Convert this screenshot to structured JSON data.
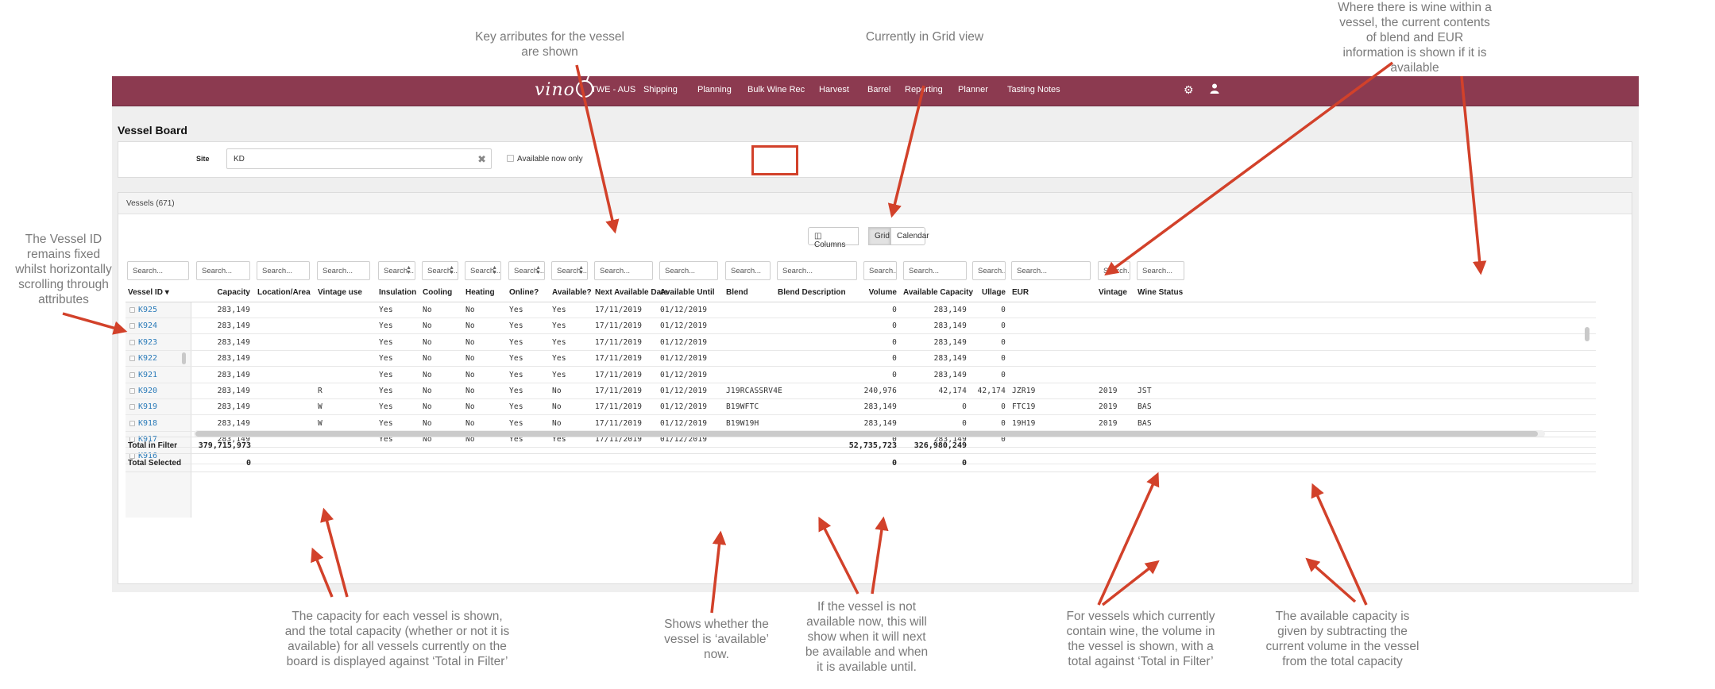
{
  "annotations": {
    "key_attributes": "Key arributes for the vessel\nare shown",
    "grid_view": "Currently in Grid view",
    "wine_contents": "Where there is wine within a\nvessel, the current contents\nof blend and EUR\ninformation is shown if it is\navailable",
    "vessel_id_fixed": "The Vessel ID\nremains fixed\nwhilst horizontally\nscrolling through\nattributes",
    "capacity": "The capacity for each vessel is shown,\nand the total capacity (whether or not it is\navailable) for all vessels currently on the\nboard is displayed against ‘Total in Filter’",
    "available": "Shows whether the\nvessel is ‘available’\nnow.",
    "next_available": "If the vessel is not\navailable now, this will\nshow when it will next\nbe available and when\nit is available until.",
    "volume": "For vessels which currently\ncontain wine, the volume in\nthe vessel is shown, with a\ntotal against ‘Total in Filter’",
    "available_capacity": "The available capacity is\ngiven by subtracting the\ncurrent volume in the vessel\nfrom the total capacity"
  },
  "nav": {
    "logo": "vino",
    "site": "TWE - AUS",
    "items": [
      "Shipping",
      "Planning",
      "Bulk Wine Rec",
      "Harvest",
      "Barrel",
      "Reporting",
      "Planner",
      "Tasting Notes"
    ],
    "settings_icon": "gear-icon",
    "user_icon": "user-icon"
  },
  "page_title": "Vessel Board",
  "filter": {
    "site_label": "Site",
    "site_value": "KD",
    "available_now_label": "Available now only"
  },
  "vessels_header": "Vessels (671)",
  "views": {
    "columns": "Columns",
    "grid": "Grid",
    "calendar": "Calendar",
    "active": "Grid"
  },
  "search_placeholder": "Search...",
  "columns": [
    "Vessel ID",
    "Capacity",
    "Location/Area",
    "Vintage use",
    "Insulation",
    "Cooling",
    "Heating",
    "Online?",
    "Available?",
    "Next Available Date",
    "Available Until",
    "Blend",
    "Blend Description",
    "Volume",
    "Available Capacity",
    "Ullage",
    "EUR",
    "Vintage",
    "Wine Status"
  ],
  "rows": [
    {
      "id": "K925",
      "capacity": "283,149",
      "vintage_use": "",
      "insulation": "Yes",
      "cooling": "No",
      "heating": "No",
      "online": "Yes",
      "available": "Yes",
      "next_date": "17/11/2019",
      "until": "01/12/2019",
      "blend": "",
      "volume": "0",
      "avail_cap": "283,149",
      "ullage": "0",
      "eur": "",
      "vintage": "",
      "status": ""
    },
    {
      "id": "K924",
      "capacity": "283,149",
      "vintage_use": "",
      "insulation": "Yes",
      "cooling": "No",
      "heating": "No",
      "online": "Yes",
      "available": "Yes",
      "next_date": "17/11/2019",
      "until": "01/12/2019",
      "blend": "",
      "volume": "0",
      "avail_cap": "283,149",
      "ullage": "0",
      "eur": "",
      "vintage": "",
      "status": ""
    },
    {
      "id": "K923",
      "capacity": "283,149",
      "vintage_use": "",
      "insulation": "Yes",
      "cooling": "No",
      "heating": "No",
      "online": "Yes",
      "available": "Yes",
      "next_date": "17/11/2019",
      "until": "01/12/2019",
      "blend": "",
      "volume": "0",
      "avail_cap": "283,149",
      "ullage": "0",
      "eur": "",
      "vintage": "",
      "status": ""
    },
    {
      "id": "K922",
      "capacity": "283,149",
      "vintage_use": "",
      "insulation": "Yes",
      "cooling": "No",
      "heating": "No",
      "online": "Yes",
      "available": "Yes",
      "next_date": "17/11/2019",
      "until": "01/12/2019",
      "blend": "",
      "volume": "0",
      "avail_cap": "283,149",
      "ullage": "0",
      "eur": "",
      "vintage": "",
      "status": ""
    },
    {
      "id": "K921",
      "capacity": "283,149",
      "vintage_use": "",
      "insulation": "Yes",
      "cooling": "No",
      "heating": "No",
      "online": "Yes",
      "available": "Yes",
      "next_date": "17/11/2019",
      "until": "01/12/2019",
      "blend": "",
      "volume": "0",
      "avail_cap": "283,149",
      "ullage": "0",
      "eur": "",
      "vintage": "",
      "status": ""
    },
    {
      "id": "K920",
      "capacity": "283,149",
      "vintage_use": "R",
      "insulation": "Yes",
      "cooling": "No",
      "heating": "No",
      "online": "Yes",
      "available": "No",
      "next_date": "17/11/2019",
      "until": "01/12/2019",
      "blend": "J19RCASSRV4E",
      "volume": "240,976",
      "avail_cap": "42,174",
      "ullage": "42,174",
      "eur": "JZR19",
      "vintage": "2019",
      "status": "JST"
    },
    {
      "id": "K919",
      "capacity": "283,149",
      "vintage_use": "W",
      "insulation": "Yes",
      "cooling": "No",
      "heating": "No",
      "online": "Yes",
      "available": "No",
      "next_date": "17/11/2019",
      "until": "01/12/2019",
      "blend": "B19WFTC",
      "volume": "283,149",
      "avail_cap": "0",
      "ullage": "0",
      "eur": "FTC19",
      "vintage": "2019",
      "status": "BAS"
    },
    {
      "id": "K918",
      "capacity": "283,149",
      "vintage_use": "W",
      "insulation": "Yes",
      "cooling": "No",
      "heating": "No",
      "online": "Yes",
      "available": "No",
      "next_date": "17/11/2019",
      "until": "01/12/2019",
      "blend": "B19W19H",
      "volume": "283,149",
      "avail_cap": "0",
      "ullage": "0",
      "eur": "19H19",
      "vintage": "2019",
      "status": "BAS"
    },
    {
      "id": "K917",
      "capacity": "283,149",
      "vintage_use": "",
      "insulation": "Yes",
      "cooling": "No",
      "heating": "No",
      "online": "Yes",
      "available": "Yes",
      "next_date": "17/11/2019",
      "until": "01/12/2019",
      "blend": "",
      "volume": "0",
      "avail_cap": "283,149",
      "ullage": "0",
      "eur": "",
      "vintage": "",
      "status": ""
    },
    {
      "id": "K916",
      "capacity": "",
      "vintage_use": "",
      "insulation": "",
      "cooling": "",
      "heating": "",
      "online": "",
      "available": "",
      "next_date": "",
      "until": "",
      "blend": "",
      "volume": "",
      "avail_cap": "",
      "ullage": "",
      "eur": "",
      "vintage": "",
      "status": ""
    }
  ],
  "totals": {
    "filter_label": "Total in Filter",
    "filter_capacity": "379,715,973",
    "filter_volume": "52,735,723",
    "filter_avail_cap": "326,980,249",
    "selected_label": "Total Selected",
    "selected_capacity": "0",
    "selected_volume": "0",
    "selected_avail_cap": "0"
  },
  "accent_colors": {
    "navbar": "#8c3a50",
    "arrows": "#d2412a",
    "link": "#2b7bb9"
  }
}
